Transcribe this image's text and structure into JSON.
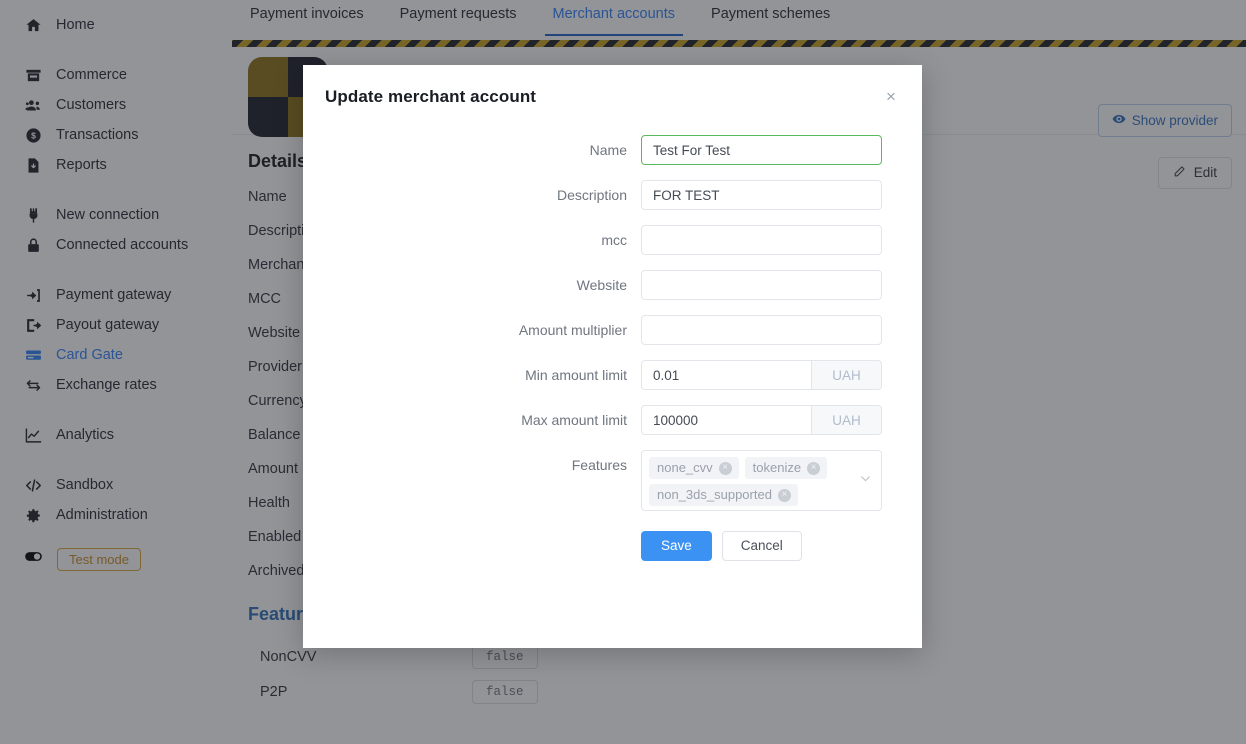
{
  "sidebar": {
    "groups": [
      {
        "items": [
          {
            "label": "Home",
            "icon": "home-icon",
            "active": false
          }
        ]
      },
      {
        "items": [
          {
            "label": "Commerce",
            "icon": "store-icon",
            "active": false
          },
          {
            "label": "Customers",
            "icon": "users-icon",
            "active": false
          },
          {
            "label": "Transactions",
            "icon": "coin-icon",
            "active": false
          },
          {
            "label": "Reports",
            "icon": "file-download-icon",
            "active": false
          }
        ]
      },
      {
        "items": [
          {
            "label": "New connection",
            "icon": "plug-icon",
            "active": false
          },
          {
            "label": "Connected accounts",
            "icon": "lock-icon",
            "active": false
          }
        ]
      },
      {
        "items": [
          {
            "label": "Payment gateway",
            "icon": "sign-in-icon",
            "active": false
          },
          {
            "label": "Payout gateway",
            "icon": "sign-out-icon",
            "active": false
          },
          {
            "label": "Card Gate",
            "icon": "credit-card-icon",
            "active": true
          },
          {
            "label": "Exchange rates",
            "icon": "exchange-icon",
            "active": false
          }
        ]
      },
      {
        "items": [
          {
            "label": "Analytics",
            "icon": "chart-line-icon",
            "active": false
          }
        ]
      },
      {
        "items": [
          {
            "label": "Sandbox",
            "icon": "code-icon",
            "active": false
          },
          {
            "label": "Administration",
            "icon": "gear-icon",
            "active": false
          }
        ]
      }
    ],
    "test_mode": {
      "label": "Test mode",
      "icon": "toggle-icon"
    }
  },
  "tabs": [
    {
      "label": "Payment invoices",
      "active": false
    },
    {
      "label": "Payment requests",
      "active": false
    },
    {
      "label": "Merchant accounts",
      "active": true
    },
    {
      "label": "Payment schemes",
      "active": false
    }
  ],
  "panel": {
    "show_provider_label": "Show provider",
    "edit_label": "Edit",
    "details_title": "Details",
    "detail_rows": [
      {
        "key": "Name"
      },
      {
        "key": "Description"
      },
      {
        "key": "Merchant"
      },
      {
        "key": "MCC"
      },
      {
        "key": "Website"
      },
      {
        "key": "Provider"
      },
      {
        "key": "Currency"
      },
      {
        "key": "Balance"
      },
      {
        "key": "Amount limits"
      },
      {
        "key": "Health"
      },
      {
        "key": "Enabled"
      },
      {
        "key": "Archived"
      }
    ],
    "features_title": "Features",
    "feature_rows": [
      {
        "key": "NonCVV",
        "value": "false"
      },
      {
        "key": "P2P",
        "value": "false"
      }
    ]
  },
  "modal": {
    "title": "Update merchant account",
    "close_label": "×",
    "fields": {
      "name": {
        "label": "Name",
        "value": "Test For Test",
        "placeholder": ""
      },
      "description": {
        "label": "Description",
        "value": "FOR TEST",
        "placeholder": ""
      },
      "mcc": {
        "label": "mcc",
        "value": "",
        "placeholder": ""
      },
      "website": {
        "label": "Website",
        "value": "",
        "placeholder": ""
      },
      "multiplier": {
        "label": "Amount multiplier",
        "value": "",
        "placeholder": ""
      },
      "min_amount": {
        "label": "Min amount limit",
        "value": "0.01",
        "placeholder": "",
        "addon": "UAH"
      },
      "max_amount": {
        "label": "Max amount limit",
        "value": "100000",
        "placeholder": "",
        "addon": "UAH"
      },
      "features": {
        "label": "Features",
        "chips": [
          "none_cvv",
          "tokenize",
          "non_3ds_supported"
        ],
        "remove_glyph": "×"
      }
    },
    "save_label": "Save",
    "cancel_label": "Cancel"
  },
  "colors": {
    "accent_blue": "#2d7ff9",
    "primary_button": "#3c92f3",
    "focus_green": "#5cb85c",
    "hazard_yellow": "#c8a322",
    "hazard_dark": "#1c1f28",
    "test_mode_orange": "#c98a26"
  }
}
